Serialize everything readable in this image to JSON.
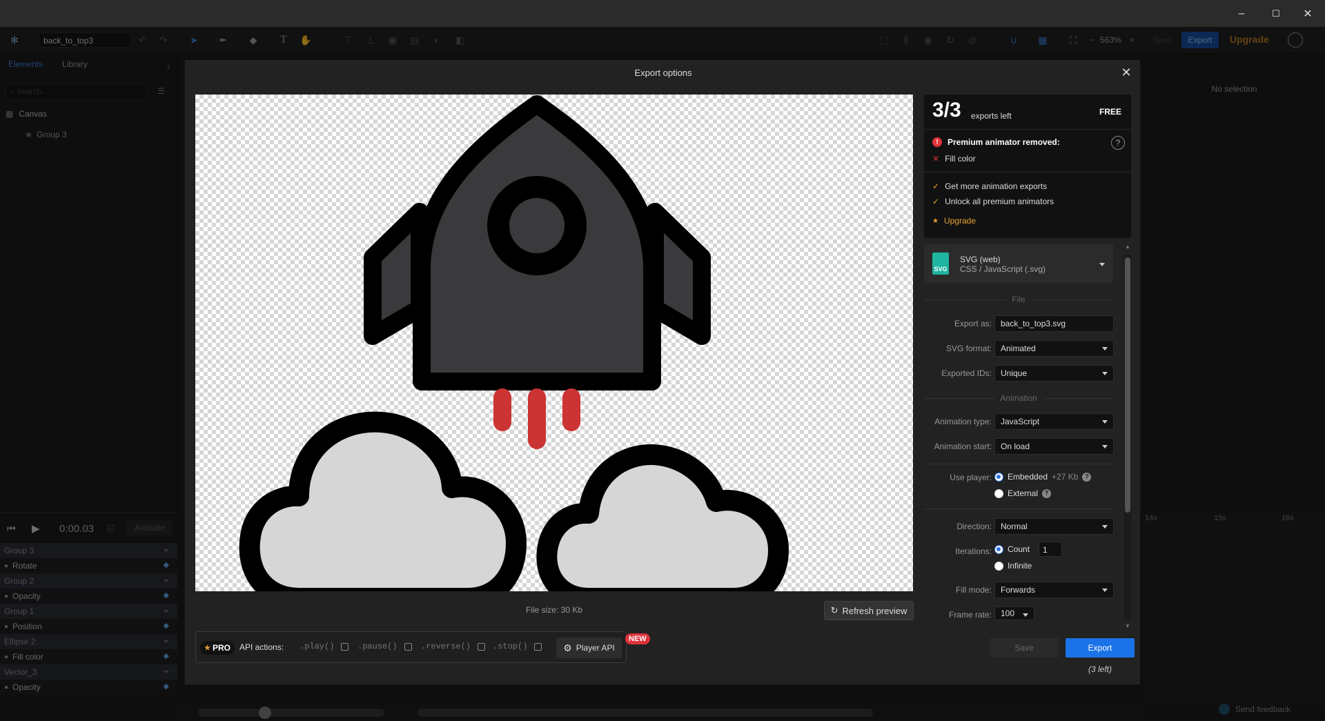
{
  "app": {
    "document_name": "back_to_top3",
    "zoom": "563%",
    "save_label": "Save",
    "export_label": "Export",
    "upgrade_label": "Upgrade",
    "window_controls": {
      "minimize": "–",
      "maximize": "☐",
      "close": "✕"
    }
  },
  "left_panel": {
    "tabs": [
      "Elements",
      "Library"
    ],
    "search_placeholder": "Search...",
    "tree": [
      "Canvas",
      "Group 3"
    ]
  },
  "timeline": {
    "time": "0:00.03",
    "animate_label": "Animate",
    "rows": [
      {
        "label": "Group 3",
        "kind": "group"
      },
      {
        "label": "Rotate",
        "kind": "prop"
      },
      {
        "label": "Group 2",
        "kind": "group"
      },
      {
        "label": "Opacity",
        "kind": "prop"
      },
      {
        "label": "Group 1",
        "kind": "group"
      },
      {
        "label": "Position",
        "kind": "prop"
      },
      {
        "label": "Ellipse 2",
        "kind": "group"
      },
      {
        "label": "Fill color",
        "kind": "prop"
      },
      {
        "label": "Vector_3",
        "kind": "group"
      },
      {
        "label": "Opacity",
        "kind": "prop"
      }
    ],
    "ruler_ticks": [
      "14s",
      "15s",
      "16s"
    ]
  },
  "right_panel": {
    "empty_label": "No selection"
  },
  "footer": {
    "feedback_label": "Send feedback"
  },
  "dialog": {
    "title": "Export options",
    "file_size": "File size: 30 Kb",
    "refresh_label": "Refresh preview",
    "api": {
      "pro_label": "PRO",
      "actions_label": "API actions:",
      "actions": [
        ".play()",
        ".pause()",
        ".reverse()",
        ".stop()"
      ],
      "player_api_label": "Player API",
      "new_badge": "NEW"
    },
    "exports": {
      "count": "3/3",
      "left_label": "exports left",
      "plan": "FREE",
      "warning_title": "Premium animator removed:",
      "removed_item": "Fill color",
      "benefits": [
        "Get more animation exports",
        "Unlock all premium animators"
      ],
      "upgrade_label": "Upgrade"
    },
    "format": {
      "icon_label": "SVG",
      "name": "SVG (web)",
      "desc": "CSS / JavaScript (.svg)"
    },
    "sections": {
      "file": "File",
      "animation": "Animation"
    },
    "fields": {
      "export_as_label": "Export as:",
      "export_as_value": "back_to_top3.svg",
      "svg_format_label": "SVG format:",
      "svg_format_value": "Animated",
      "exported_ids_label": "Exported IDs:",
      "exported_ids_value": "Unique",
      "animation_type_label": "Animation type:",
      "animation_type_value": "JavaScript",
      "animation_start_label": "Animation start:",
      "animation_start_value": "On load",
      "use_player_label": "Use player:",
      "player_embedded": "Embedded",
      "player_embedded_size": "+27 Kb",
      "player_external": "External",
      "direction_label": "Direction:",
      "direction_value": "Normal",
      "iterations_label": "Iterations:",
      "iterations_count_label": "Count",
      "iterations_count_value": "1",
      "iterations_infinite_label": "Infinite",
      "fill_mode_label": "Fill mode:",
      "fill_mode_value": "Forwards",
      "frame_rate_label": "Frame rate:",
      "frame_rate_value": "100"
    },
    "save_label": "Save",
    "export_label": "Export",
    "exports_left_note": "(3 left)"
  },
  "colors": {
    "accent": "#1a73e8",
    "upgrade": "#e8a030",
    "warning": "#e0323a",
    "rocket_body": "#3a3a3d",
    "cloud": "#d6d6d6",
    "flame": "#cc3333"
  }
}
